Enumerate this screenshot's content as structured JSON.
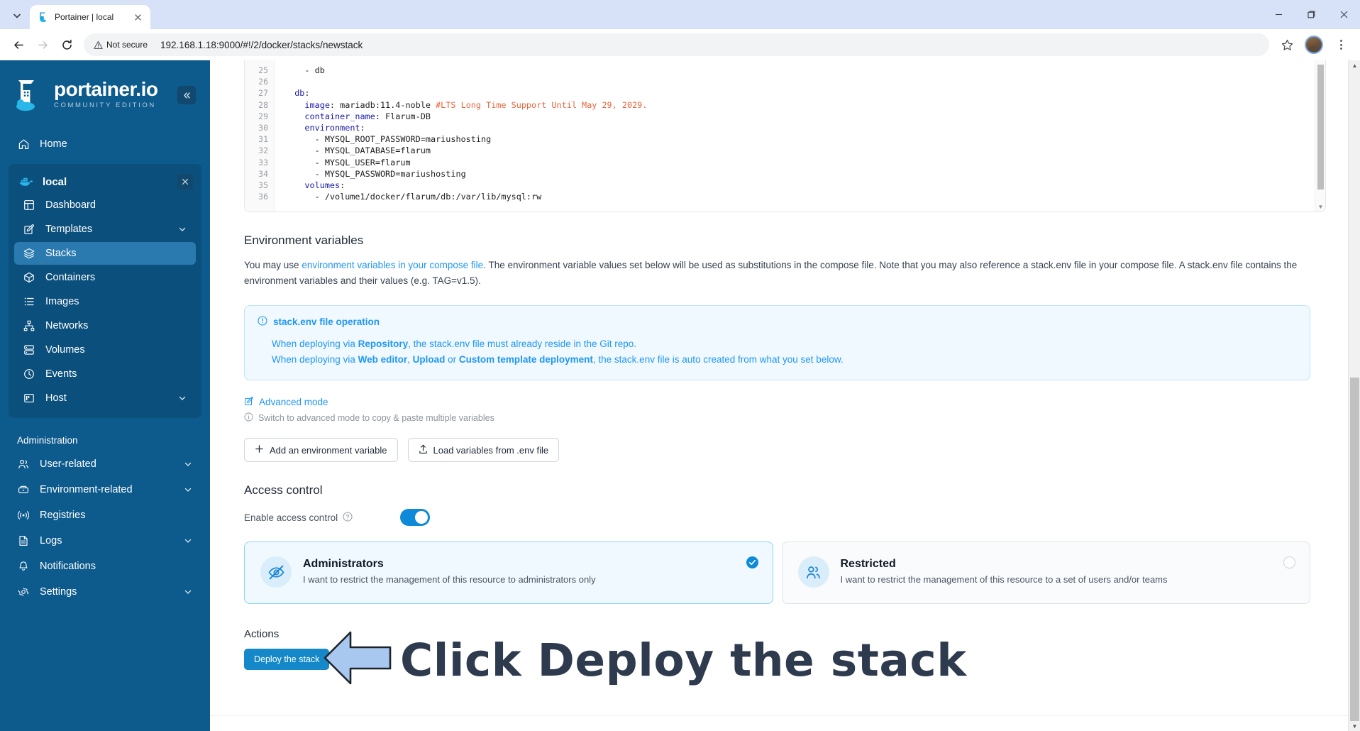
{
  "browser": {
    "tab": {
      "title": "Portainer | local",
      "favicon_icon": "portainer-favicon",
      "close_icon": "close-icon"
    },
    "tab_search_icon": "tab-search-chevron-icon",
    "nav": {
      "back_icon": "back-arrow-icon",
      "forward_icon": "forward-arrow-icon",
      "reload_icon": "reload-icon"
    },
    "security": {
      "label": "Not secure",
      "icon": "warning-triangle-icon"
    },
    "url": "192.168.1.18:9000/#!/2/docker/stacks/newstack",
    "star_icon": "bookmark-star-icon",
    "profile_icon": "profile-avatar",
    "menu_icon": "kebab-menu-icon",
    "window": {
      "minimize": "minimize-icon",
      "maximize": "maximize-icon",
      "close": "window-close-icon"
    }
  },
  "sidebar": {
    "brand": {
      "name": "portainer.io",
      "edition": "COMMUNITY EDITION"
    },
    "collapse_icon": "collapse-chevrons-icon",
    "home": {
      "label": "Home",
      "icon": "home-icon"
    },
    "environment": {
      "name": "local",
      "icon": "docker-whale-icon",
      "close_icon": "close-icon",
      "items": [
        {
          "label": "Dashboard",
          "icon": "dashboard-icon",
          "chevron": false
        },
        {
          "label": "Templates",
          "icon": "templates-edit-icon",
          "chevron": true
        },
        {
          "label": "Stacks",
          "icon": "stacks-layers-icon",
          "chevron": false,
          "active": true
        },
        {
          "label": "Containers",
          "icon": "container-box-icon",
          "chevron": false
        },
        {
          "label": "Images",
          "icon": "images-list-icon",
          "chevron": false
        },
        {
          "label": "Networks",
          "icon": "networks-icon",
          "chevron": false
        },
        {
          "label": "Volumes",
          "icon": "volumes-database-icon",
          "chevron": false
        },
        {
          "label": "Events",
          "icon": "events-clock-icon",
          "chevron": false
        },
        {
          "label": "Host",
          "icon": "host-server-icon",
          "chevron": true
        }
      ]
    },
    "administration": {
      "title": "Administration",
      "items": [
        {
          "label": "User-related",
          "icon": "users-icon",
          "chevron": true
        },
        {
          "label": "Environment-related",
          "icon": "environment-box-icon",
          "chevron": true
        },
        {
          "label": "Registries",
          "icon": "registries-broadcast-icon",
          "chevron": false
        },
        {
          "label": "Logs",
          "icon": "logs-document-icon",
          "chevron": true
        },
        {
          "label": "Notifications",
          "icon": "bell-icon",
          "chevron": false
        },
        {
          "label": "Settings",
          "icon": "gear-icon",
          "chevron": true
        }
      ]
    }
  },
  "editor": {
    "first_line_number": 25,
    "lines": [
      {
        "n": 25,
        "segments": [
          {
            "t": "    - db",
            "c": "c-val"
          }
        ]
      },
      {
        "n": 26,
        "segments": [
          {
            "t": "",
            "c": "c-val"
          }
        ]
      },
      {
        "n": 27,
        "segments": [
          {
            "t": "  db",
            "c": "c-key"
          },
          {
            "t": ":",
            "c": "c-val"
          }
        ]
      },
      {
        "n": 28,
        "segments": [
          {
            "t": "    image",
            "c": "c-key"
          },
          {
            "t": ": mariadb:11.4-noble ",
            "c": "c-val"
          },
          {
            "t": "#LTS Long Time Support Until May 29, 2029.",
            "c": "c-comment"
          }
        ]
      },
      {
        "n": 29,
        "segments": [
          {
            "t": "    container_name",
            "c": "c-key"
          },
          {
            "t": ": Flarum-DB",
            "c": "c-val"
          }
        ]
      },
      {
        "n": 30,
        "segments": [
          {
            "t": "    environment",
            "c": "c-key"
          },
          {
            "t": ":",
            "c": "c-val"
          }
        ]
      },
      {
        "n": 31,
        "segments": [
          {
            "t": "      - MYSQL_ROOT_PASSWORD=mariushosting",
            "c": "c-val"
          }
        ]
      },
      {
        "n": 32,
        "segments": [
          {
            "t": "      - MYSQL_DATABASE=flarum",
            "c": "c-val"
          }
        ]
      },
      {
        "n": 33,
        "segments": [
          {
            "t": "      - MYSQL_USER=flarum",
            "c": "c-val"
          }
        ]
      },
      {
        "n": 34,
        "segments": [
          {
            "t": "      - MYSQL_PASSWORD=mariushosting",
            "c": "c-val"
          }
        ]
      },
      {
        "n": 35,
        "segments": [
          {
            "t": "    volumes",
            "c": "c-key"
          },
          {
            "t": ":",
            "c": "c-val"
          }
        ]
      },
      {
        "n": 36,
        "segments": [
          {
            "t": "      - /volume1/docker/flarum/db:/var/lib/mysql:rw",
            "c": "c-val"
          }
        ]
      }
    ]
  },
  "env_vars": {
    "title": "Environment variables",
    "desc_part1": "You may use ",
    "desc_link": "environment variables in your compose file",
    "desc_part2": ". The environment variable values set below will be used as substitutions in the compose file. Note that you may also reference a stack.env file in your compose file. A stack.env file contains the environment variables and their values (e.g. TAG=v1.5).",
    "info": {
      "icon": "info-circle-icon",
      "title": "stack.env file operation",
      "line1_a": "When deploying via ",
      "line1_b": "Repository",
      "line1_c": ", the stack.env file must already reside in the Git repo.",
      "line2_a": "When deploying via ",
      "line2_b": "Web editor",
      "line2_c": ", ",
      "line2_d": "Upload",
      "line2_e": " or ",
      "line2_f": "Custom template deployment",
      "line2_g": ", the stack.env file is auto created from what you set below."
    },
    "advanced_mode": {
      "label": "Advanced mode",
      "icon": "edit-pencil-icon"
    },
    "advanced_hint": {
      "label": "Switch to advanced mode to copy & paste multiple variables",
      "icon": "info-circle-icon"
    },
    "add_button": {
      "label": "Add an environment variable",
      "icon": "plus-icon"
    },
    "load_button": {
      "label": "Load variables from .env file",
      "icon": "upload-icon"
    }
  },
  "access_control": {
    "title": "Access control",
    "toggle_label": "Enable access control",
    "help_icon": "question-circle-icon",
    "toggle_on": true,
    "options": [
      {
        "title": "Administrators",
        "desc": "I want to restrict the management of this resource to administrators only",
        "icon": "eye-off-icon",
        "selected": true,
        "check_icon": "check-circle-icon"
      },
      {
        "title": "Restricted",
        "desc": "I want to restrict the management of this resource to a set of users and/or teams",
        "icon": "users-group-icon",
        "selected": false,
        "check_icon": "radio-empty-icon"
      }
    ]
  },
  "actions": {
    "title": "Actions",
    "deploy_button": "Deploy the stack",
    "annotation_text": "Click Deploy the stack",
    "annotation_arrow_icon": "left-arrow-annotation-icon",
    "annotation_color": "#2e3a4d",
    "arrow_fill": "#a8c8ef"
  },
  "colors": {
    "sidebar_bg": "#0d5a8c",
    "sidebar_group_bg": "#0b4f7c",
    "sidebar_active": "#2a7ab0",
    "accent": "#2196f3",
    "primary_button": "#1488c8",
    "toggle_on": "#0e8ad8"
  }
}
